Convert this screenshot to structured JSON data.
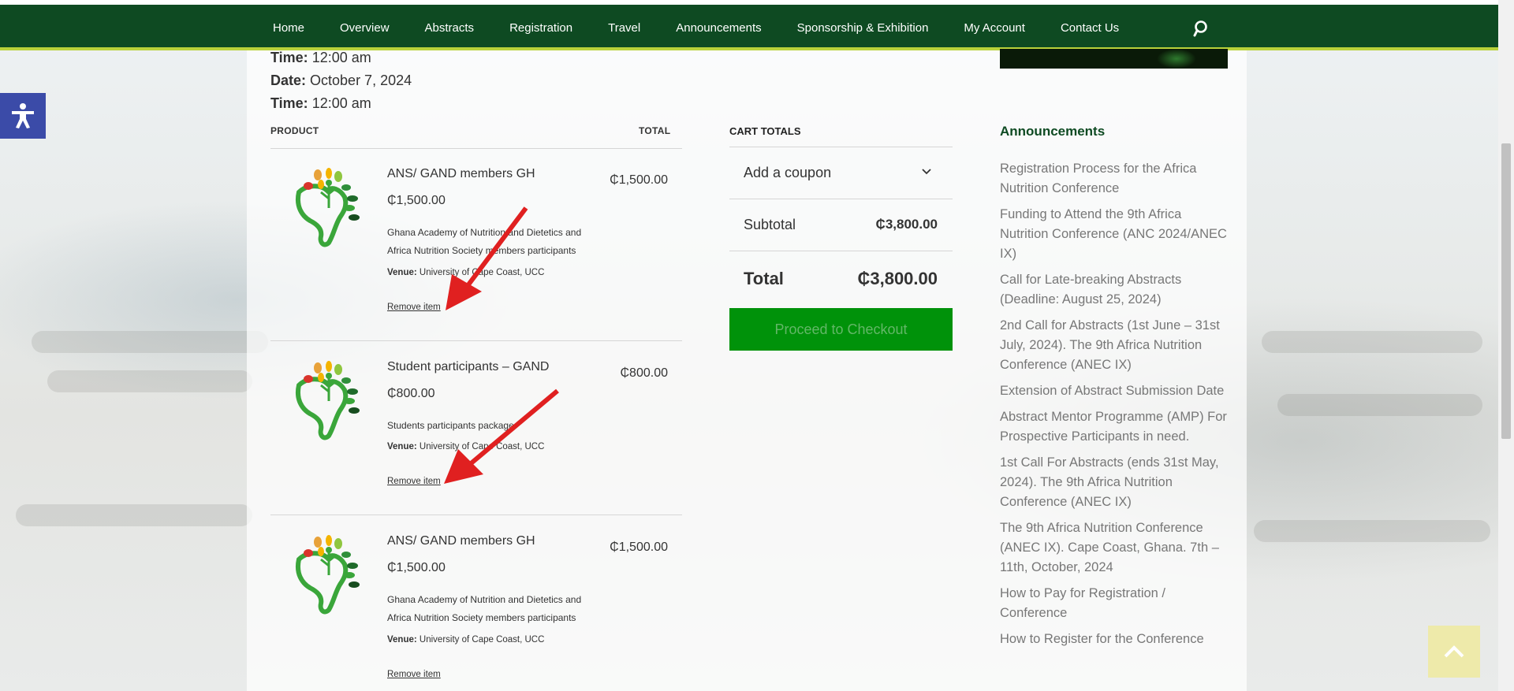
{
  "nav": {
    "items": [
      "Home",
      "Overview",
      "Abstracts",
      "Registration",
      "Travel",
      "Announcements",
      "Sponsorship & Exhibition",
      "My Account",
      "Contact Us"
    ]
  },
  "event": {
    "time_label": "Time:",
    "time_value": "12:00 am",
    "date_label": "Date:",
    "date_value": "October 7, 2024",
    "time2_label": "Time:",
    "time2_value": "12:00 am"
  },
  "table": {
    "product_header": "PRODUCT",
    "total_header": "TOTAL"
  },
  "products": [
    {
      "name": "ANS/ GAND members GH",
      "price": "₵1,500.00",
      "desc": "Ghana Academy of Nutrition and Dietetics and Africa Nutrition Society members participants",
      "venue_label": "Venue:",
      "venue": "University of Cape Coast, UCC",
      "remove": "Remove item",
      "total": "₵1,500.00"
    },
    {
      "name": "Student participants – GAND",
      "price": "₵800.00",
      "desc": "Students participants package",
      "venue_label": "Venue:",
      "venue": "University of Cape Coast, UCC",
      "remove": "Remove item",
      "total": "₵800.00"
    },
    {
      "name": "ANS/ GAND members GH",
      "price": "₵1,500.00",
      "desc": "Ghana Academy of Nutrition and Dietetics and Africa Nutrition Society members participants",
      "venue_label": "Venue:",
      "venue": "University of Cape Coast, UCC",
      "remove": "Remove item",
      "total": "₵1,500.00"
    }
  ],
  "cart": {
    "title": "CART TOTALS",
    "coupon": "Add a coupon",
    "subtotal_label": "Subtotal",
    "subtotal_value": "₵3,800.00",
    "total_label": "Total",
    "total_value": "₵3,800.00",
    "checkout": "Proceed to Checkout"
  },
  "sidebar": {
    "title": "Announcements",
    "items": [
      "Registration Process for the Africa Nutrition Conference",
      "Funding to Attend the 9th Africa Nutrition Conference (ANC 2024/ANEC IX)",
      "Call for Late-breaking Abstracts (Deadline: August 25, 2024)",
      "2nd Call for Abstracts (1st June – 31st July, 2024). The 9th Africa Nutrition Conference (ANEC IX)",
      "Extension of Abstract Submission Date",
      "Abstract Mentor Programme (AMP) For Prospective Participants in need.",
      "1st Call For Abstracts (ends 31st May, 2024). The 9th Africa Nutrition Conference (ANEC IX)",
      "The 9th Africa Nutrition Conference (ANEC IX). Cape Coast, Ghana. 7th – 11th, October, 2024",
      "How to Pay for Registration / Conference",
      "How to Register for the Conference"
    ]
  },
  "colors": {
    "nav_bg": "#0e4a22",
    "nav_accent": "#b9d23a",
    "checkout_bg": "#00920a",
    "annotation_arrow": "#e02020",
    "access_bg": "#3b4ba8"
  },
  "icons": [
    "search-icon",
    "accessibility-icon",
    "chevron-down-icon",
    "back-to-top-icon",
    "africa-nutrition-logo"
  ]
}
